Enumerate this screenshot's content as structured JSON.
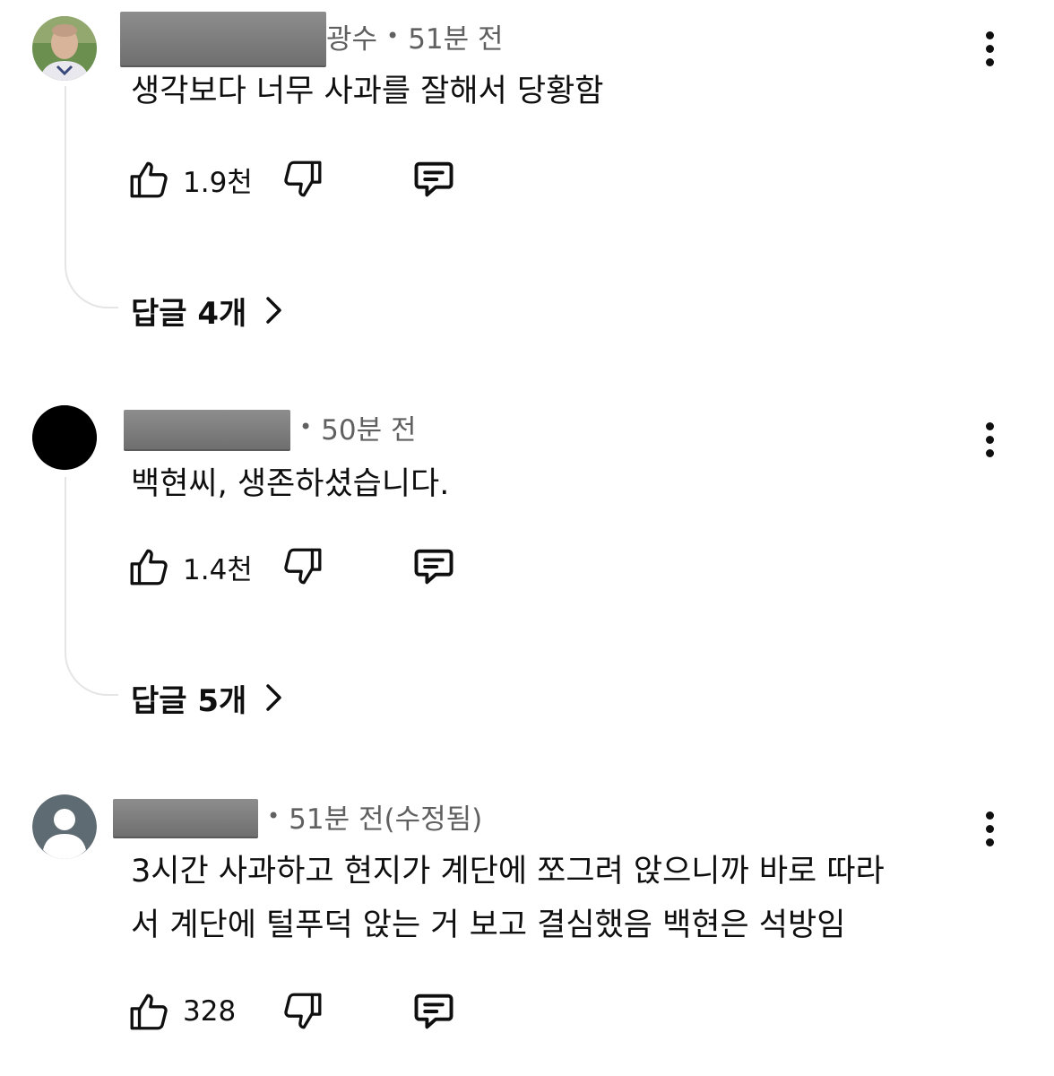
{
  "comments": [
    {
      "author_suffix": "광수",
      "time": "51분 전",
      "text": [
        "생각보다 너무 사과를 잘해서 당황함"
      ],
      "likes": "1.9천",
      "replies_label": "답글 4개",
      "avatar": "photo-avatar"
    },
    {
      "author_suffix": "",
      "time": "50분 전",
      "text": [
        "백현씨, 생존하셨습니다."
      ],
      "likes": "1.4천",
      "replies_label": "답글 5개",
      "avatar": "black-avatar"
    },
    {
      "author_suffix": "",
      "time": "51분 전(수정됨)",
      "text": [
        "3시간 사과하고 현지가 계단에 쪼그려 앉으니까 바로 따라",
        "서 계단에 털푸덕 앉는 거 보고 결심했음 백현은 석방임"
      ],
      "likes": "328",
      "replies_label": "",
      "avatar": "default-user-avatar"
    }
  ],
  "icons": {
    "like": "thumbs-up-icon",
    "dislike": "thumbs-down-icon",
    "reply": "reply-comment-icon",
    "more": "more-vertical-icon",
    "chevron": "chevron-right-icon"
  },
  "colors": {
    "meta_text": "#606060",
    "text": "#0f0f0f",
    "thread_line": "#e5e5e5",
    "redaction": "#7e7e7e"
  }
}
